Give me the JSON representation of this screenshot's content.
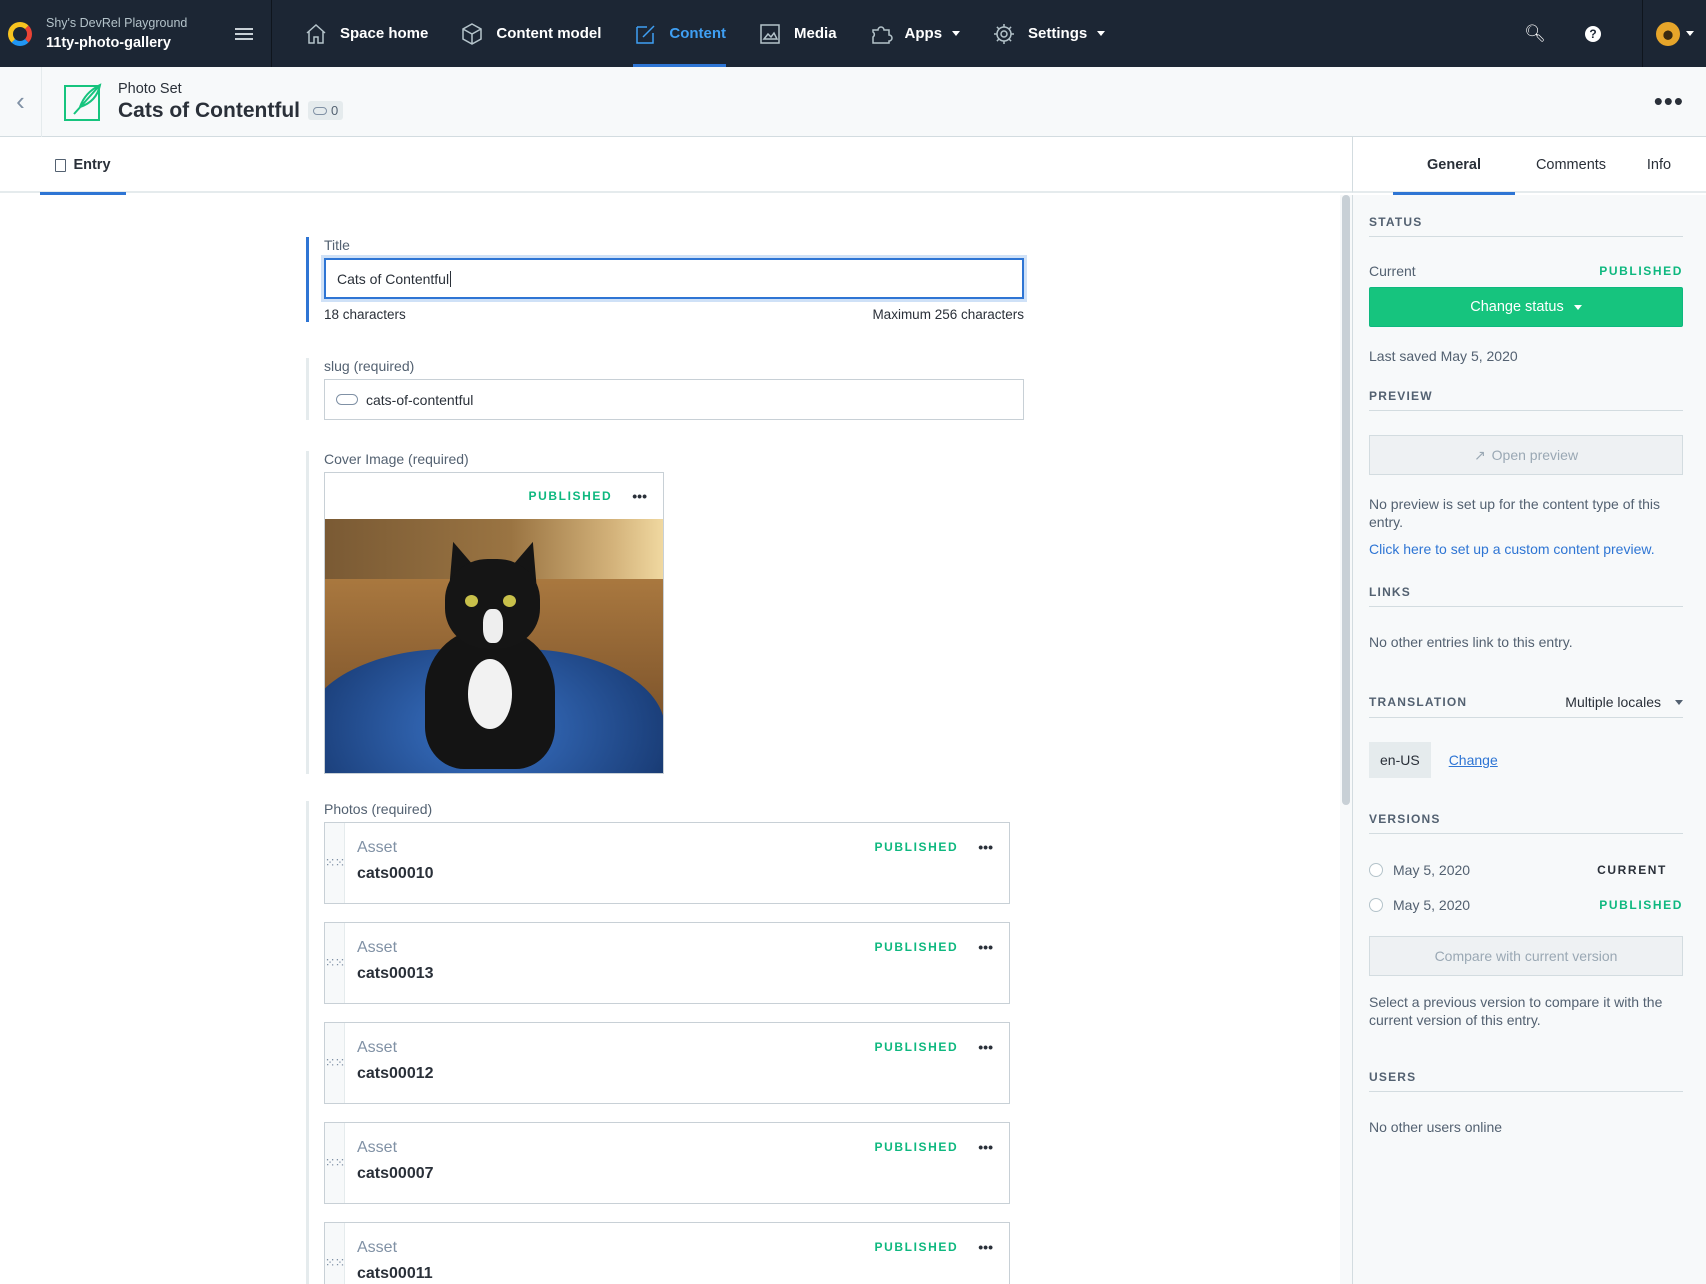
{
  "space": {
    "org": "Shy's DevRel Playground",
    "name": "11ty-photo-gallery"
  },
  "nav": [
    {
      "label": "Space home",
      "icon": "home-icon"
    },
    {
      "label": "Content model",
      "icon": "cube-icon"
    },
    {
      "label": "Content",
      "icon": "content-edit-icon",
      "active": true
    },
    {
      "label": "Media",
      "icon": "media-icon"
    },
    {
      "label": "Apps",
      "icon": "puzzle-icon"
    },
    {
      "label": "Settings",
      "icon": "gear-icon"
    }
  ],
  "entry": {
    "content_type": "Photo Set",
    "title": "Cats of Contentful",
    "reference_count": "0",
    "tab": "Entry"
  },
  "fields": {
    "title": {
      "label": "Title",
      "value": "Cats of Contentful",
      "count": "18 characters",
      "max": "Maximum 256 characters"
    },
    "slug": {
      "label": "slug (required)",
      "value": "cats-of-contentful"
    },
    "cover": {
      "label": "Cover Image (required)",
      "status": "PUBLISHED"
    },
    "photos": {
      "label": "Photos (required)",
      "items": [
        {
          "type": "Asset",
          "title": "cats00010",
          "status": "PUBLISHED"
        },
        {
          "type": "Asset",
          "title": "cats00013",
          "status": "PUBLISHED"
        },
        {
          "type": "Asset",
          "title": "cats00012",
          "status": "PUBLISHED"
        },
        {
          "type": "Asset",
          "title": "cats00007",
          "status": "PUBLISHED"
        },
        {
          "type": "Asset",
          "title": "cats00011",
          "status": "PUBLISHED"
        }
      ]
    }
  },
  "sidebar": {
    "tabs": [
      "General",
      "Comments",
      "Info"
    ],
    "status": {
      "heading": "STATUS",
      "current_label": "Current",
      "current_value": "PUBLISHED",
      "button": "Change status",
      "last_saved": "Last saved May 5, 2020"
    },
    "preview": {
      "heading": "PREVIEW",
      "button": "Open preview",
      "note": "No preview is set up for the content type of this entry.",
      "link": "Click here to set up a custom content preview."
    },
    "links": {
      "heading": "LINKS",
      "text": "No other entries link to this entry."
    },
    "translation": {
      "heading": "TRANSLATION",
      "mode": "Multiple locales",
      "locale": "en-US",
      "change": "Change"
    },
    "versions": {
      "heading": "VERSIONS",
      "items": [
        {
          "date": "May 5, 2020",
          "status": "CURRENT"
        },
        {
          "date": "May 5, 2020",
          "status": "PUBLISHED"
        }
      ],
      "compare": "Compare with current version",
      "note": "Select a previous version to compare it with the current version of this entry."
    },
    "users": {
      "heading": "USERS",
      "text": "No other users online"
    }
  },
  "colors": {
    "nav_bg": "#1c2634",
    "accent": "#2e75d4",
    "published": "#0eb87f"
  }
}
